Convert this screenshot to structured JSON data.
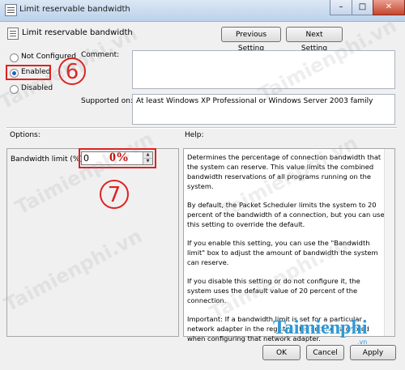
{
  "window": {
    "title": "Limit reservable bandwidth",
    "minimize": "–",
    "maximize": "□",
    "close": "✕"
  },
  "policy": {
    "name": "Limit reservable bandwidth"
  },
  "nav": {
    "previous": "Previous Setting",
    "next": "Next Setting"
  },
  "state": {
    "options": [
      {
        "label": "Not Configured",
        "checked": false
      },
      {
        "label": "Enabled",
        "checked": true
      },
      {
        "label": "Disabled",
        "checked": false
      }
    ]
  },
  "comment": {
    "label": "Comment:",
    "value": ""
  },
  "supported": {
    "label": "Supported on:",
    "value": "At least Windows XP Professional or Windows Server 2003 family"
  },
  "options_label": "Options:",
  "help_label": "Help:",
  "bandwidth": {
    "label": "Bandwidth limit (%):",
    "value": "0",
    "overlay": "0%"
  },
  "annotations": {
    "step6": "6",
    "step7": "7",
    "highlight_color": "#dd2222"
  },
  "help": {
    "paragraphs": [
      "Determines the percentage of connection bandwidth that the system can reserve. This value limits the combined bandwidth reservations of all programs running on the system.",
      "By default, the Packet Scheduler limits the system to 20 percent of the bandwidth of a connection, but you can use this setting to override the default.",
      "If you enable this setting, you can use the \"Bandwidth limit\" box to adjust the amount of bandwidth the system can reserve.",
      "If you disable this setting or do not configure it, the system uses the default value of 20 percent of the connection.",
      "Important: If a bandwidth limit is set for a particular network adapter in the registry, this setting is ignored when configuring that network adapter."
    ]
  },
  "buttons": {
    "ok": "OK",
    "cancel": "Cancel",
    "apply": "Apply"
  },
  "watermark": {
    "text": "Taimienphi.vn",
    "logo": "Taimienphi",
    "logo_sub": ".vn"
  }
}
